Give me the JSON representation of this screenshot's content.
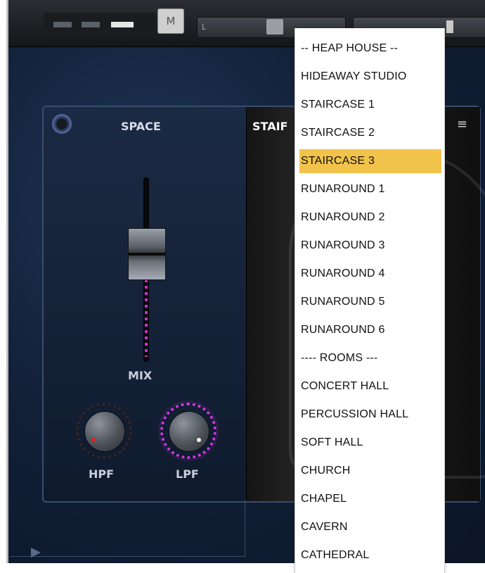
{
  "topbar": {
    "mono_label": "M",
    "balance_left": "L"
  },
  "panel": {
    "title": "SPACE",
    "preset_visible": "STAIF",
    "mix_label": "MIX",
    "hpf_label": "HPF",
    "lpf_label": "LPF",
    "menu_icon": "menu-icon",
    "accent": "#d338e6"
  },
  "preset_menu": {
    "selected_index": 4,
    "items": [
      "-- HEAP HOUSE --",
      "HIDEAWAY STUDIO",
      "STAIRCASE 1",
      "STAIRCASE 2",
      "STAIRCASE 3",
      "RUNAROUND 1",
      "RUNAROUND 2",
      "RUNAROUND 3",
      "RUNAROUND 4",
      "RUNAROUND 5",
      "RUNAROUND 6",
      "---- ROOMS ---",
      "CONCERT HALL",
      "PERCUSSION HALL",
      "SOFT HALL",
      "CHURCH",
      "CHAPEL",
      "CAVERN",
      "CATHEDRAL"
    ],
    "highlight_color": "#f2c34b"
  }
}
